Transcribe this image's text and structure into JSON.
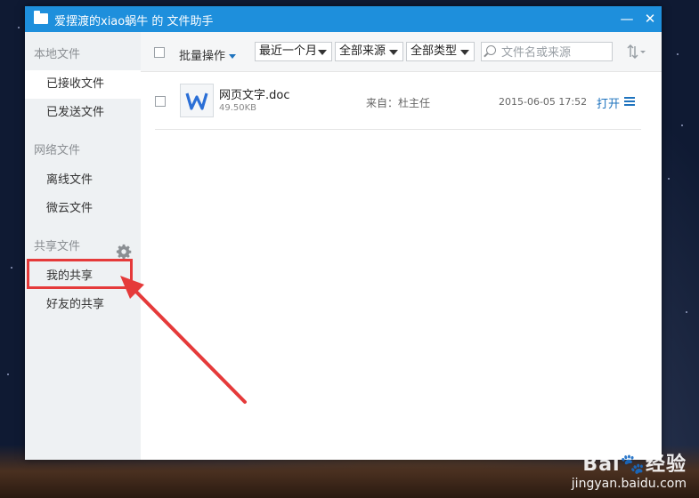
{
  "window": {
    "title": "爱摆渡的xiao蜗牛 的 文件助手",
    "minimize_glyph": "—",
    "close_glyph": "✕"
  },
  "sidebar": {
    "sections": [
      {
        "label": "本地文件"
      },
      {
        "label": "网络文件"
      },
      {
        "label": "共享文件"
      }
    ],
    "items": [
      {
        "label": "已接收文件",
        "active": true
      },
      {
        "label": "已发送文件"
      },
      {
        "label": "离线文件"
      },
      {
        "label": "微云文件"
      },
      {
        "label": "我的共享"
      },
      {
        "label": "好友的共享"
      }
    ]
  },
  "toolbar": {
    "batch_label": "批量操作",
    "time_filter": "最近一个月",
    "source_filter": "全部来源",
    "type_filter": "全部类型",
    "search_placeholder": "文件名或来源"
  },
  "files": [
    {
      "name": "网页文字.doc",
      "size": "49.50KB",
      "source": "来自：杜主任",
      "date": "2015-06-05 17:52",
      "open_label": "打开"
    }
  ],
  "watermark": {
    "brand": "Bai",
    "brand_cn": "经验",
    "url": "jingyan.baidu.com"
  },
  "colors": {
    "title_bar": "#1e8fdc",
    "accent": "#1e73be",
    "annotation": "#e53a3a"
  }
}
